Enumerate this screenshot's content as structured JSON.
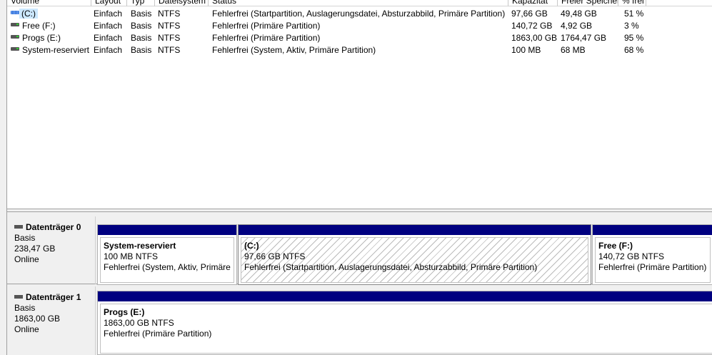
{
  "columns": [
    "Volume",
    "Layout",
    "Typ",
    "Dateisystem",
    "Status",
    "Kapazität",
    "Freier Speicher",
    "% frei"
  ],
  "volumes": [
    {
      "name": "(C:)",
      "icon": "striped-volume-icon",
      "layout": "Einfach",
      "type": "Basis",
      "fs": "NTFS",
      "status": "Fehlerfrei (Startpartition, Auslagerungsdatei, Absturzabbild, Primäre Partition)",
      "capacity": "97,66 GB",
      "free": "49,48 GB",
      "pct": "51 %"
    },
    {
      "name": "Free (F:)",
      "icon": "drive-icon",
      "layout": "Einfach",
      "type": "Basis",
      "fs": "NTFS",
      "status": "Fehlerfrei (Primäre Partition)",
      "capacity": "140,72 GB",
      "free": "4,92 GB",
      "pct": "3 %"
    },
    {
      "name": "Progs (E:)",
      "icon": "drive-icon",
      "layout": "Einfach",
      "type": "Basis",
      "fs": "NTFS",
      "status": "Fehlerfrei (Primäre Partition)",
      "capacity": "1863,00 GB",
      "free": "1764,47 GB",
      "pct": "95 %"
    },
    {
      "name": "System-reserviert",
      "icon": "drive-icon",
      "layout": "Einfach",
      "type": "Basis",
      "fs": "NTFS",
      "status": "Fehlerfrei (System, Aktiv, Primäre Partition)",
      "capacity": "100 MB",
      "free": "68 MB",
      "pct": "68 %"
    }
  ],
  "disks": [
    {
      "name": "Datenträger 0",
      "type": "Basis",
      "size": "238,47 GB",
      "state": "Online",
      "partitions": [
        {
          "title": "System-reserviert",
          "size": "100 MB NTFS",
          "status": "Fehlerfrei (System, Aktiv, Primäre Partition)"
        },
        {
          "title": "(C:)",
          "size": "97,66 GB NTFS",
          "status": "Fehlerfrei (Startpartition, Auslagerungsdatei, Absturzabbild, Primäre Partition)"
        },
        {
          "title": "Free  (F:)",
          "size": "140,72 GB NTFS",
          "status": "Fehlerfrei (Primäre Partition)"
        }
      ]
    },
    {
      "name": "Datenträger 1",
      "type": "Basis",
      "size": "1863,00 GB",
      "state": "Online",
      "partitions": [
        {
          "title": "Progs  (E:)",
          "size": "1863,00 GB NTFS",
          "status": "Fehlerfrei (Primäre Partition)"
        }
      ]
    }
  ]
}
